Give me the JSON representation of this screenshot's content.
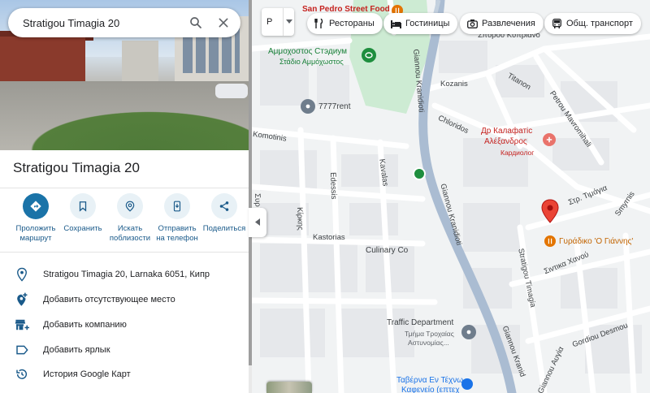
{
  "search": {
    "value": "Stratigou Timagia 20"
  },
  "place": {
    "title": "Stratigou Timagia 20"
  },
  "actions": [
    {
      "label": "Проложить\nмаршрут"
    },
    {
      "label": "Сохранить"
    },
    {
      "label": "Искать\nпоблизости"
    },
    {
      "label": "Отправить\nна телефон"
    },
    {
      "label": "Поделиться"
    }
  ],
  "details": {
    "address": "Stratigou Timagia 20, Larnaka 6051, Кипр",
    "add_missing_place": "Добавить отсутствующее место",
    "add_business": "Добавить компанию",
    "add_label": "Добавить ярлык",
    "history": "История Google Карт"
  },
  "map_controls": {
    "layer_label": "Р"
  },
  "chips": [
    {
      "label": "Рестораны",
      "icon": "fork-knife-icon"
    },
    {
      "label": "Гостиницы",
      "icon": "bed-icon"
    },
    {
      "label": "Развлечения",
      "icon": "camera-icon"
    },
    {
      "label": "Общ. транспорт",
      "icon": "bus-icon"
    }
  ],
  "map": {
    "pois": {
      "san_pedro": "San Pedro Street Food",
      "stadium_gr": "Αμμόχωστος Στάδιο",
      "stadium_ru": "Αμμοχοστος Стэдиум",
      "stadium_sub": "Στάδιο Αμμόχωστος",
      "rent": "7777rent",
      "doctor_ru": "Др Калафатіс",
      "doctor_gr": "Αλέξανδρος",
      "doctor_sub": "Кардиолог",
      "giradiko": "Γυράδικο 'Ο Γιάννης'",
      "culinary": "Culinary Co",
      "traffic": "Traffic Department",
      "traffic_sub1": "Τμήμα Τροχαίας",
      "traffic_sub2": "Αστυνομίας...",
      "taverna1": "Ταβέρνα Εν Τέχνω",
      "taverna2": "Καφενείο (επτεχ"
    },
    "streets": {
      "spyrou_kyprianou": "Σπύρου Κυπριανο",
      "kozanis": "Kozanis",
      "titanon": "Titanon",
      "chloridos": "Chloridos",
      "petrou_mavromihali": "Petrou Mavromihali",
      "gianniou_kranidioti_1": "Giannou Kranidioti",
      "gianniou_kranidioti_2": "Giannou Kranidioti",
      "gianniou_kranidioti_3": "Giannou Kranid",
      "komotinis": "Komotinis",
      "edessis": "Edessis",
      "kavalas": "Kavalas",
      "kirkis": "Κίρκης",
      "kastorias": "Kastorias",
      "str_timagia": "Στρ. Τιμάγια",
      "smyrnis": "Smyrnis",
      "sintika_chanou": "Σιντικα Χανού",
      "stratigou_timagia": "Stratigou Timagia",
      "gordiou_desmou": "Gordiou Desmou",
      "giannou_avgia": "Giannou Αυγία",
      "surias": "Συρ"
    }
  },
  "colors": {
    "accent": "#1a73a8",
    "pin": "#ea4335",
    "park": "#cdebd3",
    "road_main": "#aabcd2"
  }
}
